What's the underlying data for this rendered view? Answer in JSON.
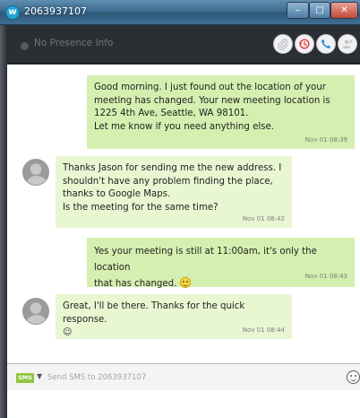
{
  "window": {
    "title": "2063937107",
    "app_icon_letter": "w",
    "controls": {
      "minimize": "‒",
      "maximize": "□",
      "close": "✕"
    }
  },
  "header": {
    "presence_text": "No Presence Info",
    "icons": [
      "attachment-icon",
      "history-icon",
      "phone-icon",
      "add-contact-icon"
    ]
  },
  "messages": [
    {
      "direction": "outgoing",
      "text": "Good morning. I just found out the location of your\nmeeting has changed. Your new meeting location is\n1225 4th Ave, Seattle, WA 98101.\nLet me know if you need anything else.",
      "time": "Nov 01 08:39"
    },
    {
      "direction": "incoming",
      "text": "Thanks Jason for sending me the new address. I\nshouldn't have any problem finding the place,\nthanks to Google Maps.\nIs the meeting for the same time?",
      "time": "Nov 01 08:42"
    },
    {
      "direction": "outgoing",
      "text": "Yes your meeting is still at 11:00am, it's only the location\nthat has changed.",
      "emoji": "smiley",
      "time": "Nov 01 08:43"
    },
    {
      "direction": "incoming",
      "text": "Great, I'll be there. Thanks for the quick response.",
      "emoji_text": "☺",
      "time": "Nov 01 08:44"
    }
  ],
  "composer": {
    "mode_badge": "SMS",
    "mode_caret": "▼",
    "placeholder": "Send SMS to 2063937107",
    "value": ""
  },
  "colors": {
    "outgoing_bubble": "#d4efb0",
    "incoming_bubble": "#e8f7d2",
    "sms_badge": "#8ec63f",
    "header_bg": "#2b2f34"
  }
}
